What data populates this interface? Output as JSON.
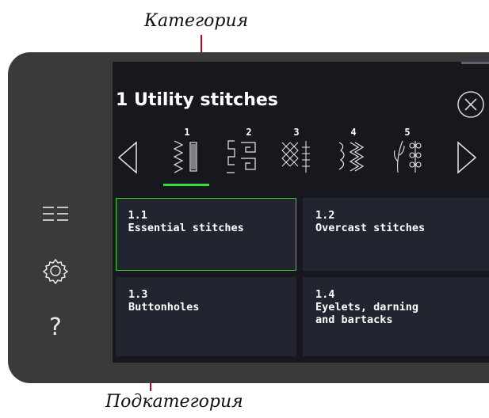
{
  "annotations": {
    "top": "Категория",
    "bottom": "Подкатегория",
    "leader_color": "#c0001a"
  },
  "sidebar": {
    "items": [
      {
        "icon": "list-menu-icon"
      },
      {
        "icon": "gear-icon"
      },
      {
        "icon": "help-question-icon",
        "label": "?"
      }
    ]
  },
  "header": {
    "title": "1  Utility stitches",
    "close_icon": "close-circle-icon"
  },
  "categories": {
    "prev_icon": "triangle-left-icon",
    "next_icon": "triangle-right-icon",
    "items": [
      {
        "number": "1",
        "icon": "utility-stitch-icon",
        "selected": true
      },
      {
        "number": "2",
        "icon": "overcast-stitch-icon",
        "selected": false
      },
      {
        "number": "3",
        "icon": "cross-stitch-icon",
        "selected": false
      },
      {
        "number": "4",
        "icon": "satin-stitch-icon",
        "selected": false
      },
      {
        "number": "5",
        "icon": "decorative-stitch-icon",
        "selected": false
      }
    ],
    "active_color": "#33e033"
  },
  "subcategories": [
    {
      "number": "1.1",
      "label": "Essential stitches",
      "selected": true
    },
    {
      "number": "1.2",
      "label": "Overcast stitches",
      "selected": false
    },
    {
      "number": "1.3",
      "label": "Buttonholes",
      "selected": false
    },
    {
      "number": "1.4",
      "label": "Eyelets, darning\nand bartacks",
      "selected": false
    }
  ],
  "colors": {
    "screen_bg": "#16181d",
    "tile_bg": "#222530",
    "device_bezel": "#3a3a3a",
    "selected_border": "#31d631"
  }
}
